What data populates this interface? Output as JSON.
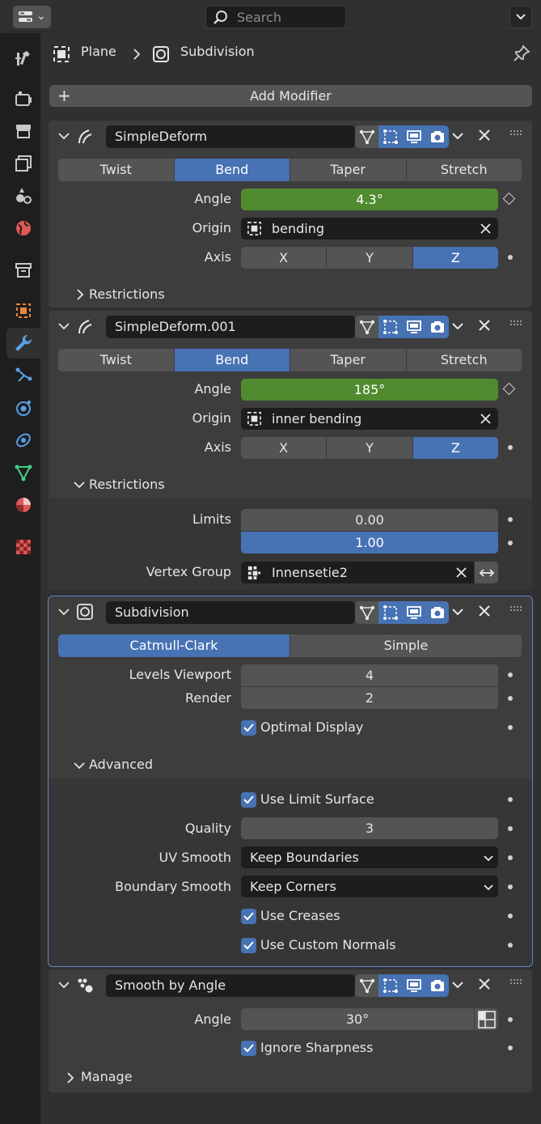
{
  "search": {
    "placeholder": "Search"
  },
  "breadcrumb": {
    "object": "Plane",
    "modifier": "Subdivision"
  },
  "add_modifier": "Add Modifier",
  "colors": {
    "accent": "#4772b3",
    "animated_green": "#508b2f",
    "panel": "#3d3d3d",
    "background": "#303030"
  },
  "modifiers": [
    {
      "name": "SimpleDeform",
      "modes": [
        "Twist",
        "Bend",
        "Taper",
        "Stretch"
      ],
      "active_mode": "Bend",
      "angle_label": "Angle",
      "angle": "4.3°",
      "origin_label": "Origin",
      "origin": "bending",
      "axis_label": "Axis",
      "axes": [
        "X",
        "Y",
        "Z"
      ],
      "active_axis": "Z",
      "restrictions": "Restrictions"
    },
    {
      "name": "SimpleDeform.001",
      "modes": [
        "Twist",
        "Bend",
        "Taper",
        "Stretch"
      ],
      "active_mode": "Bend",
      "angle_label": "Angle",
      "angle": "185°",
      "origin_label": "Origin",
      "origin": "inner bending",
      "axis_label": "Axis",
      "axes": [
        "X",
        "Y",
        "Z"
      ],
      "active_axis": "Z",
      "restrictions": "Restrictions",
      "limits_label": "Limits",
      "limit_min": "0.00",
      "limit_max": "1.00",
      "vgroup_label": "Vertex Group",
      "vgroup": "Innensetie2"
    },
    {
      "name": "Subdivision",
      "modes": [
        "Catmull-Clark",
        "Simple"
      ],
      "active_mode": "Catmull-Clark",
      "levels_label": "Levels Viewport",
      "levels": "4",
      "render_label": "Render",
      "render": "2",
      "optimal": "Optimal Display",
      "advanced": "Advanced",
      "limit_surface": "Use Limit Surface",
      "quality_label": "Quality",
      "quality": "3",
      "uv_label": "UV Smooth",
      "uv": "Keep Boundaries",
      "boundary_label": "Boundary Smooth",
      "boundary": "Keep Corners",
      "creases": "Use Creases",
      "normals": "Use Custom Normals"
    },
    {
      "name": "Smooth by Angle",
      "angle_label": "Angle",
      "angle": "30°",
      "ignore": "Ignore Sharpness",
      "manage": "Manage"
    }
  ]
}
